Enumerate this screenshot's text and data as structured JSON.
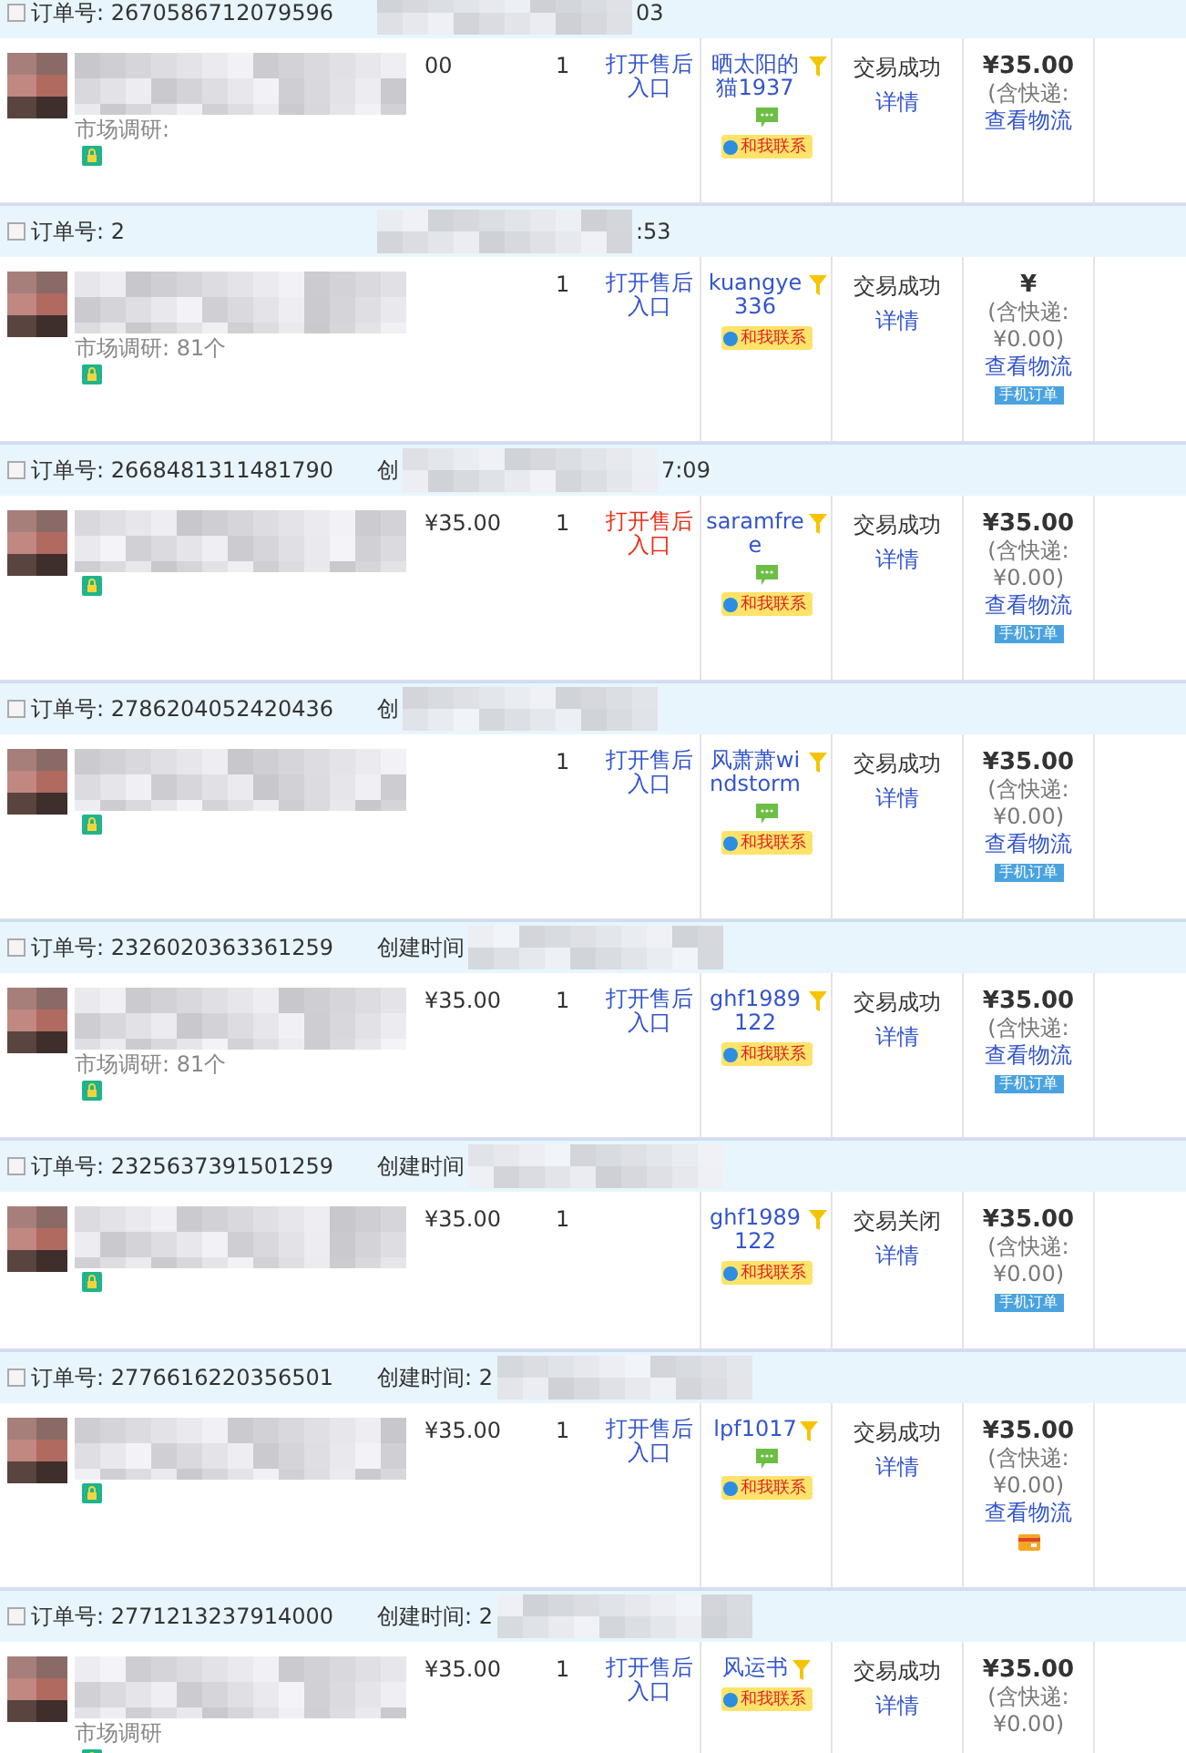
{
  "orders": [
    {
      "checked": false,
      "order_label": "订单号:",
      "order_no": "2670586712079596",
      "created_tail": "03",
      "price": "00",
      "quantity": "1",
      "after_sale": {
        "text": "打开售后入口",
        "highlighted": false
      },
      "buyer": "晒太阳的猫1937",
      "message_icon": true,
      "contact": "和我联系",
      "status": "交易成功",
      "detail": "详情",
      "total": "¥35.00",
      "shipping_label": "(含快递:",
      "product_note": "市场调研:",
      "logistics": "查看物流"
    },
    {
      "checked": false,
      "order_label": "订单号:",
      "order_no": "2",
      "created_tail": ":53",
      "quantity": "1",
      "after_sale": {
        "text": "打开售后入口",
        "highlighted": false
      },
      "buyer": "kuangye336",
      "message_icon": false,
      "contact": "和我联系",
      "status": "交易成功",
      "detail": "详情",
      "total": "¥",
      "shipping_label": "(含快递:",
      "shipping_value": "¥0.00)",
      "product_note": "市场调研: 81个",
      "logistics": "查看物流",
      "mobile_badge": "手机订单"
    },
    {
      "checked": false,
      "order_label": "订单号:",
      "order_no": "2668481311481790",
      "created_label": "创",
      "created_tail": "7:09",
      "price": "¥35.00",
      "quantity": "1",
      "after_sale": {
        "text": "打开售后入口",
        "highlighted": true
      },
      "buyer": "saramfree",
      "message_icon": true,
      "contact": "和我联系",
      "status": "交易成功",
      "detail": "详情",
      "total": "¥35.00",
      "shipping_label": "(含快递:",
      "shipping_value": "¥0.00)",
      "logistics": "查看物流",
      "mobile_badge": "手机订单"
    },
    {
      "checked": false,
      "order_label": "订单号:",
      "order_no": "2786204052420436",
      "created_label": "创",
      "quantity": "1",
      "after_sale": {
        "text": "打开售后入口",
        "highlighted": false
      },
      "buyer": "风萧萧windstorm",
      "message_icon": true,
      "contact": "和我联系",
      "status": "交易成功",
      "detail": "详情",
      "total": "¥35.00",
      "shipping_label": "(含快递:",
      "shipping_value": "¥0.00)",
      "logistics": "查看物流",
      "mobile_badge": "手机订单"
    },
    {
      "checked": false,
      "order_label": "订单号:",
      "order_no": "2326020363361259",
      "created_label": "创建时间",
      "price": "¥35.00",
      "quantity": "1",
      "after_sale": {
        "text": "打开售后入口",
        "highlighted": false
      },
      "buyer": "ghf1989122",
      "message_icon": false,
      "contact": "和我联系",
      "status": "交易成功",
      "detail": "详情",
      "total": "¥35.00",
      "shipping_label": "(含快递:",
      "product_note": "市场调研: 81个",
      "logistics": "查看物流",
      "mobile_badge": "手机订单"
    },
    {
      "checked": false,
      "order_label": "订单号:",
      "order_no": "2325637391501259",
      "created_label": "创建时间",
      "price": "¥35.00",
      "quantity": "1",
      "buyer": "ghf1989122",
      "message_icon": false,
      "contact": "和我联系",
      "status": "交易关闭",
      "detail": "详情",
      "total": "¥35.00",
      "shipping_label": "(含快递:",
      "shipping_value": "¥0.00)",
      "mobile_badge": "手机订单"
    },
    {
      "checked": false,
      "order_label": "订单号:",
      "order_no": "2776616220356501",
      "created_label": "创建时间: 2",
      "price": "¥35.00",
      "quantity": "1",
      "after_sale": {
        "text": "打开售后入口",
        "highlighted": false
      },
      "buyer": "lpf1017",
      "message_icon": true,
      "contact": "和我联系",
      "status": "交易成功",
      "detail": "详情",
      "total": "¥35.00",
      "shipping_label": "(含快递:",
      "shipping_value": "¥0.00)",
      "logistics": "查看物流",
      "card_icon": true
    },
    {
      "checked": false,
      "order_label": "订单号:",
      "order_no": "2771213237914000",
      "created_label": "创建时间: 2",
      "price": "¥35.00",
      "quantity": "1",
      "after_sale": {
        "text": "打开售后入口",
        "highlighted": false
      },
      "buyer": "风运书",
      "message_icon": false,
      "contact": "和我联系",
      "status": "交易成功",
      "detail": "详情",
      "total": "¥35.00",
      "shipping_label": "(含快递:",
      "shipping_value": "¥0.00)",
      "product_note": "市场调研"
    }
  ]
}
